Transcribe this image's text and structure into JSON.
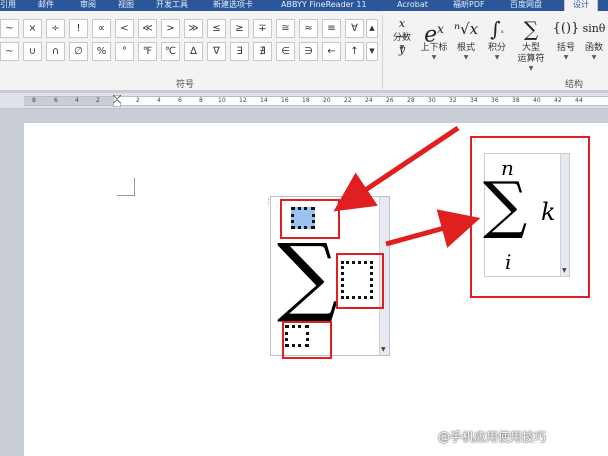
{
  "tabs": [
    "引用",
    "邮件",
    "审阅",
    "视图",
    "开发工具",
    "新建选项卡",
    "ABBYY FineReader 11",
    "Acrobat",
    "福昕PDF",
    "百度网盘",
    "设计"
  ],
  "symbols": {
    "row1": [
      "~",
      "×",
      "÷",
      "!",
      "∝",
      "<",
      "≪",
      ">",
      "≫",
      "≤",
      "≥",
      "∓",
      "≅",
      "≈",
      "≡",
      "∀"
    ],
    "row2": [
      "∼",
      "∪",
      "∩",
      "∅",
      "%",
      "°",
      "℉",
      "℃",
      "∆",
      "∇",
      "∃",
      "∄",
      "∈",
      "∋",
      "←",
      "↑"
    ],
    "group_label": "符号"
  },
  "structures": {
    "group_label": "结构",
    "buttons": [
      {
        "icon": "x/y",
        "label": "分数"
      },
      {
        "icon": "eˣ",
        "label": "上下标"
      },
      {
        "icon": "ⁿ√x",
        "label": "根式"
      },
      {
        "icon": "∫",
        "label": "积分"
      },
      {
        "icon": "∑",
        "label": "大型\n运算符"
      },
      {
        "icon": "{()}",
        "label": "括号"
      },
      {
        "icon": "sinθ",
        "label": "函数"
      }
    ]
  },
  "ruler": {
    "numbers": [
      "8",
      "6",
      "4",
      "2",
      "",
      "2",
      "4",
      "6",
      "8",
      "10",
      "12",
      "14",
      "16",
      "18",
      "20",
      "22",
      "24",
      "26",
      "28",
      "30",
      "32",
      "34",
      "36",
      "38",
      "40",
      "42",
      "44"
    ]
  },
  "equation_zoom": {
    "upper": "n",
    "operator": "∑",
    "lower": "i",
    "body": "k"
  },
  "watermark": "@手机应用使用技巧"
}
